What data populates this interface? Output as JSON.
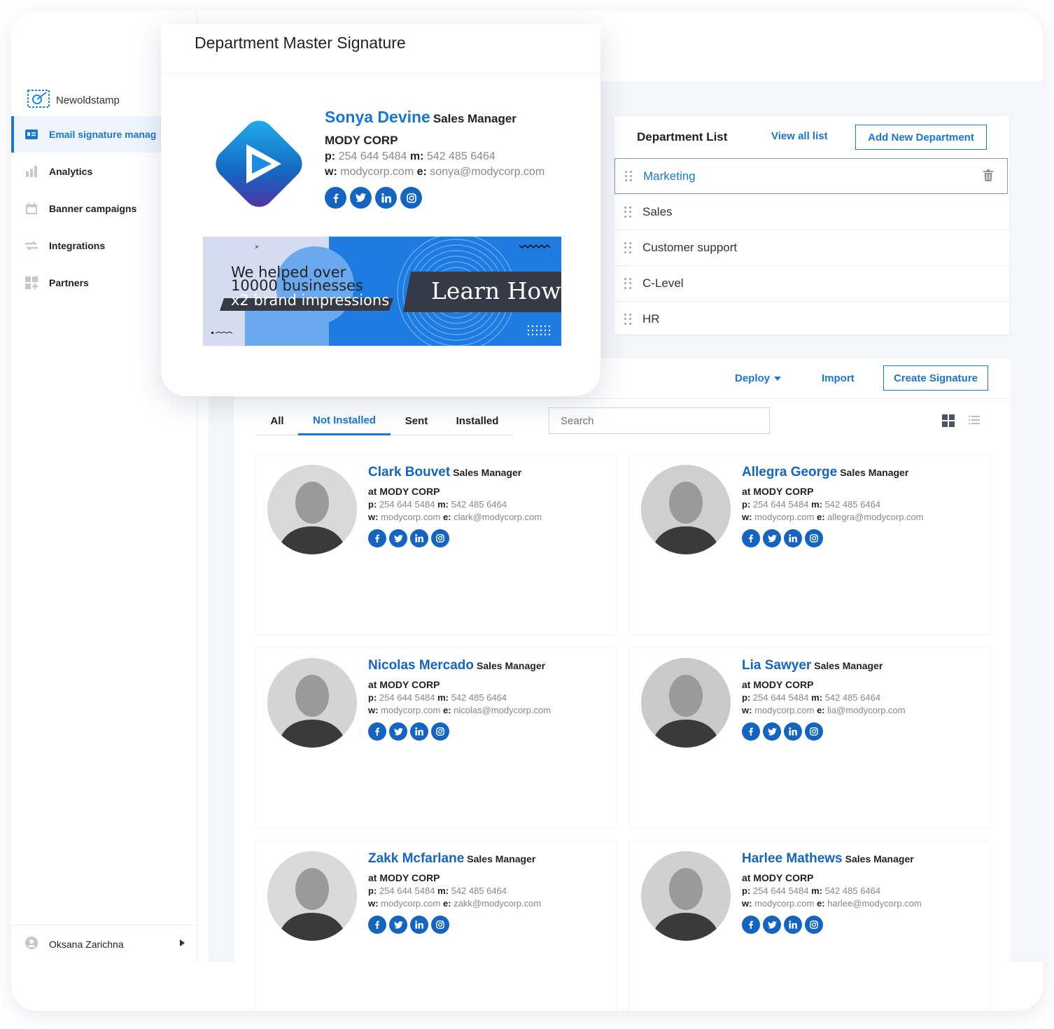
{
  "brand": {
    "name": "Newoldstamp"
  },
  "sidebar": {
    "items": [
      {
        "label": "Email signature manag",
        "icon": "id-card-icon",
        "active": true
      },
      {
        "label": "Analytics",
        "icon": "bar-chart-icon",
        "active": false
      },
      {
        "label": "Banner campaigns",
        "icon": "calendar-icon",
        "active": false
      },
      {
        "label": "Integrations",
        "icon": "arrows-icon",
        "active": false
      },
      {
        "label": "Partners",
        "icon": "grid-plus-icon",
        "active": false
      }
    ],
    "user": "Oksana Zarichna"
  },
  "popup": {
    "title": "Department Master Signature",
    "signature": {
      "name": "Sonya Devine",
      "role": "Sales Manager",
      "company": "MODY CORP",
      "phone_label": "p:",
      "phone": "254 644 5484",
      "mobile_label": "m:",
      "mobile": "542 485 6464",
      "web_label": "w:",
      "web": "modycorp.com",
      "email_label": "e:",
      "email": "sonya@modycorp.com"
    },
    "banner": {
      "line1": "We helped over",
      "line2": "10000 businesses",
      "line3": "x2 brand impressions",
      "cta": "Learn How"
    }
  },
  "departments": {
    "title": "Department List",
    "view_all": "View all list",
    "add_button": "Add New Department",
    "items": [
      "Marketing",
      "Sales",
      "Customer support",
      "C-Level",
      "HR"
    ],
    "selected": "Marketing"
  },
  "toolbar": {
    "deploy": "Deploy",
    "import": "Import",
    "create": "Create Signature"
  },
  "tabs": [
    "All",
    "Not Installed",
    "Sent",
    "Installed"
  ],
  "active_tab": "Not Installed",
  "search": {
    "placeholder": "Search"
  },
  "signatures": [
    {
      "name": "Clark Bouvet",
      "role": "Sales Manager",
      "company": "at MODY CORP",
      "p": "254 644 5484",
      "m": "542 485 6464",
      "w": "modycorp.com",
      "e": "clark@modycorp.com"
    },
    {
      "name": "Allegra George",
      "role": "Sales Manager",
      "company": "at MODY CORP",
      "p": "254 644 5484",
      "m": "542 485 6464",
      "w": "modycorp.com",
      "e": "allegra@modycorp.com"
    },
    {
      "name": "Nicolas Mercado",
      "role": "Sales Manager",
      "company": "at MODY CORP",
      "p": "254 644 5484",
      "m": "542 485 6464",
      "w": "modycorp.com",
      "e": "nicolas@modycorp.com"
    },
    {
      "name": "Lia Sawyer",
      "role": "Sales Manager",
      "company": "at MODY CORP",
      "p": "254 644 5484",
      "m": "542 485 6464",
      "w": "modycorp.com",
      "e": "lia@modycorp.com"
    },
    {
      "name": "Zakk Mcfarlane",
      "role": "Sales Manager",
      "company": "at MODY CORP",
      "p": "254 644 5484",
      "m": "542 485 6464",
      "w": "modycorp.com",
      "e": "zakk@modycorp.com"
    },
    {
      "name": "Harlee Mathews",
      "role": "Sales Manager",
      "company": "at MODY CORP",
      "p": "254 644 5484",
      "m": "542 485 6464",
      "w": "modycorp.com",
      "e": "harlee@modycorp.com"
    }
  ],
  "labels": {
    "p": "p:",
    "m": "m:",
    "w": "w:",
    "e": "e:"
  },
  "colors": {
    "accent": "#1976d2",
    "name_blue": "#1565c0",
    "banner_blue": "#1e7be0",
    "banner_dark": "#343a46"
  }
}
